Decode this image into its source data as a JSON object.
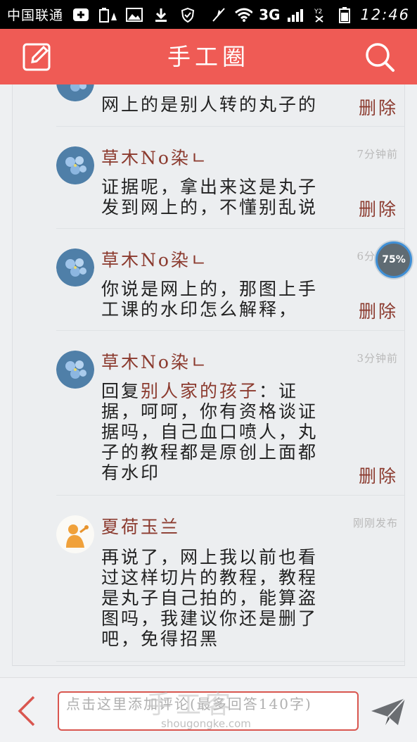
{
  "status_bar": {
    "carrier": "中国联通",
    "network": "3G",
    "time": "12:46"
  },
  "header": {
    "title": "手工圈",
    "left_icon": "edit-icon",
    "right_icon": "search-icon"
  },
  "comments": [
    {
      "user": "",
      "time": "",
      "text": "网上的是别人转的丸子的",
      "delete_label": "删除"
    },
    {
      "user": "草木No染ㄴ",
      "time": "7分钟前",
      "text": "证据呢，拿出来这是丸子发到网上的，不懂别乱说",
      "delete_label": "删除"
    },
    {
      "user": "草木No染ㄴ",
      "time": "6分钟前",
      "text": "你说是网上的，那图上手工课的水印怎么解释，",
      "delete_label": "删除"
    },
    {
      "user": "草木No染ㄴ",
      "time": "3分钟前",
      "reply_prefix": "回复",
      "reply_to": "别人家的孩子",
      "text": "：证据，呵呵，你有资格谈证据吗，自己血口喷人，丸子的教程都是原创上面都有水印",
      "delete_label": "删除"
    },
    {
      "user": "夏荷玉兰",
      "time": "刚刚发布",
      "text": "再说了，网上我以前也看过这样切片的教程，教程是丸子自己拍的，能算盗图吗，我建议你还是删了吧，免得招黑"
    }
  ],
  "progress_badge": "75%",
  "bottom_bar": {
    "placeholder": "点击这里添加评论(最多回答140字)",
    "back_icon": "back-arrow-icon",
    "send_icon": "send-icon"
  },
  "watermark": {
    "text": "手工客",
    "url": "shougongke.com"
  },
  "colors": {
    "header": "#ef5b55",
    "accent_text": "#8b3a2e",
    "input_border": "#d9564f"
  }
}
